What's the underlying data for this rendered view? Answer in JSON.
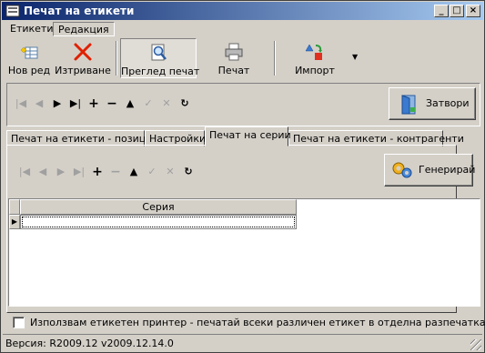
{
  "window": {
    "title": "Печат на етикети"
  },
  "menu": [
    "Етикети",
    "Редакция"
  ],
  "toolbar": {
    "buttons": [
      {
        "label": "Нов ред",
        "icon": "new-row-icon"
      },
      {
        "label": "Изтриване",
        "icon": "delete-icon"
      },
      {
        "label": "Преглед печат",
        "icon": "print-preview-icon"
      },
      {
        "label": "Печат",
        "icon": "printer-icon"
      },
      {
        "label": "Импорт",
        "icon": "import-icon"
      }
    ]
  },
  "close_button": {
    "label": "Затвори"
  },
  "tabs": [
    "Печат на етикети - позиции",
    "Настройки",
    "Печат на серии",
    "Печат на етикети - контрагенти"
  ],
  "active_tab": "Печат на серии",
  "generate_button": {
    "label": "Генерирай"
  },
  "grid": {
    "columns": [
      "Серия"
    ],
    "rows": [
      [
        ""
      ]
    ]
  },
  "navigator_glyphs": {
    "first": "|◀",
    "prior": "◀",
    "next": "▶",
    "last": "▶|",
    "insert": "+",
    "delete": "−",
    "edit": "▲",
    "post": "✓",
    "cancel": "✕",
    "refresh": "↻"
  },
  "options": {
    "label_printer_label": "Използвам етикетен принтер - печатай всеки различен етикет в отделна разпечатка",
    "label_printer_checked": false
  },
  "status": {
    "version": "Версия: R2009.12 v2009.12.14.0"
  },
  "colors": {
    "title_start": "#0a246a",
    "title_end": "#a6caf0",
    "face": "#d4d0c8"
  }
}
